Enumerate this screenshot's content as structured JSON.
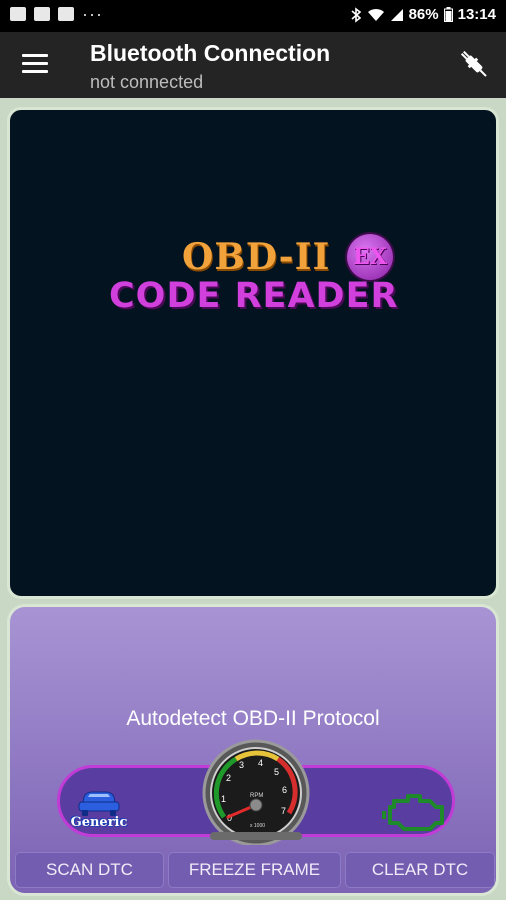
{
  "status_bar": {
    "battery": "86%",
    "time": "13:14",
    "dots": "···"
  },
  "app_bar": {
    "title": "Bluetooth Connection",
    "subtitle": "not connected"
  },
  "logo": {
    "line1": "OBD-II",
    "badge": "EX",
    "line2": "CODE READER"
  },
  "control": {
    "protocol": "Autodetect OBD-II Protocol",
    "generic_label": "Generic",
    "gauge": {
      "label": "RPM",
      "unit": "x 1000",
      "ticks": [
        "0",
        "1",
        "2",
        "3",
        "4",
        "5",
        "6",
        "7"
      ]
    },
    "buttons": {
      "scan": "SCAN DTC",
      "freeze": "FREEZE FRAME",
      "clear": "CLEAR DTC"
    }
  },
  "colors": {
    "accent_orange": "#f2a23b",
    "accent_magenta": "#d13fdc",
    "panel_purple": "#8c74c4",
    "engine_green": "#1f8a2a",
    "car_blue": "#2b5fe0"
  }
}
